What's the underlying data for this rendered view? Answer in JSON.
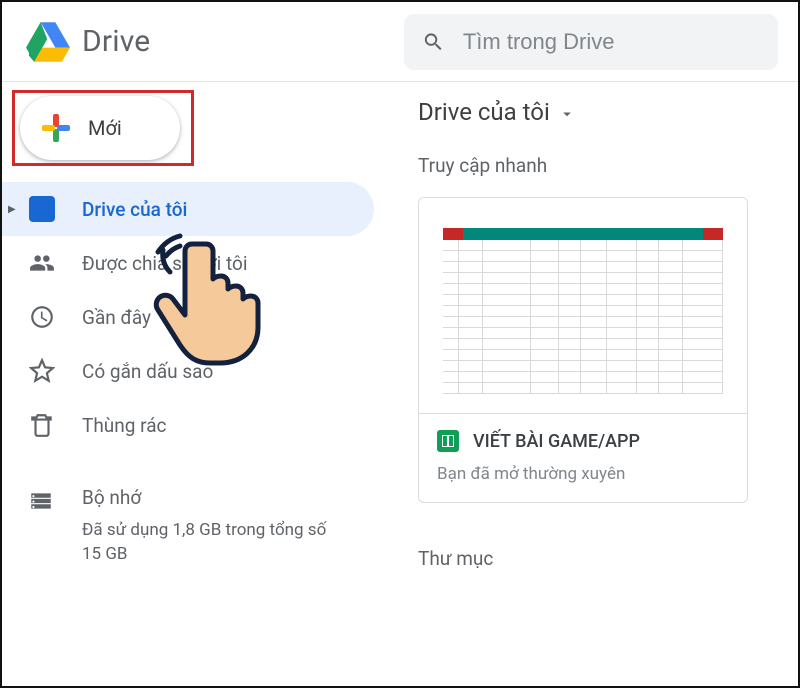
{
  "header": {
    "app_title": "Drive",
    "search_placeholder": "Tìm trong Drive"
  },
  "sidebar": {
    "new_label": "Mới",
    "items": [
      {
        "label": "Drive của tôi"
      },
      {
        "label": "Được chia sẻ với tôi"
      },
      {
        "label": "Gần đây"
      },
      {
        "label": "Có gắn dấu sao"
      },
      {
        "label": "Thùng rác"
      }
    ],
    "storage_label": "Bộ nhớ",
    "storage_sub": "Đã sử dụng 1,8 GB trong tổng số 15 GB"
  },
  "main": {
    "breadcrumb": "Drive của tôi",
    "quick_access_label": "Truy cập nhanh",
    "cards": [
      {
        "title": "VIẾT BÀI GAME/APP",
        "subtitle": "Bạn đã mở thường xuyên"
      }
    ],
    "folder_label": "Thư mục"
  }
}
